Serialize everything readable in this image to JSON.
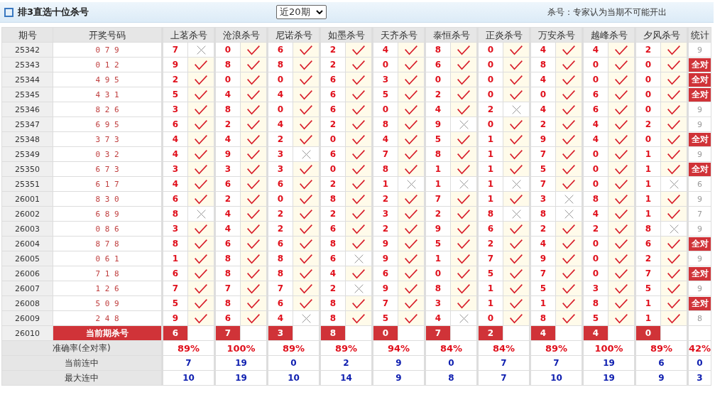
{
  "header": {
    "title": "排3直选十位杀号",
    "period_select": "近20期",
    "note": "杀号：专家认为当期不可能开出"
  },
  "columns": {
    "period": "期号",
    "draw": "开奖号码",
    "stats": "统计"
  },
  "experts": [
    {
      "name": "上茗杀号",
      "current_kill": "6",
      "accuracy": "89%",
      "current_streak": "7",
      "max_streak": "10"
    },
    {
      "name": "沧浪杀号",
      "current_kill": "7",
      "accuracy": "100%",
      "current_streak": "19",
      "max_streak": "19"
    },
    {
      "name": "尼诺杀号",
      "current_kill": "3",
      "accuracy": "89%",
      "current_streak": "0",
      "max_streak": "10"
    },
    {
      "name": "如墨杀号",
      "current_kill": "8",
      "accuracy": "89%",
      "current_streak": "2",
      "max_streak": "14"
    },
    {
      "name": "天齐杀号",
      "current_kill": "0",
      "accuracy": "94%",
      "current_streak": "9",
      "max_streak": "9"
    },
    {
      "name": "泰恒杀号",
      "current_kill": "7",
      "accuracy": "84%",
      "current_streak": "0",
      "max_streak": "8"
    },
    {
      "name": "正炎杀号",
      "current_kill": "2",
      "accuracy": "84%",
      "current_streak": "7",
      "max_streak": "7"
    },
    {
      "name": "万安杀号",
      "current_kill": "4",
      "accuracy": "89%",
      "current_streak": "7",
      "max_streak": "10"
    },
    {
      "name": "越峰杀号",
      "current_kill": "4",
      "accuracy": "100%",
      "current_streak": "19",
      "max_streak": "19"
    },
    {
      "name": "夕风杀号",
      "current_kill": "0",
      "accuracy": "89%",
      "current_streak": "6",
      "max_streak": "9"
    }
  ],
  "rows": [
    {
      "period": "25342",
      "draw": "0 7 9",
      "kills": [
        {
          "number": "7",
          "hit": false
        },
        {
          "number": "0",
          "hit": true
        },
        {
          "number": "6",
          "hit": true
        },
        {
          "number": "2",
          "hit": true
        },
        {
          "number": "4",
          "hit": true
        },
        {
          "number": "8",
          "hit": true
        },
        {
          "number": "0",
          "hit": true
        },
        {
          "number": "4",
          "hit": true
        },
        {
          "number": "4",
          "hit": true
        },
        {
          "number": "2",
          "hit": true
        }
      ],
      "stat": {
        "kind": "count",
        "text": "9"
      }
    },
    {
      "period": "25343",
      "draw": "0 1 2",
      "kills": [
        {
          "number": "9",
          "hit": true
        },
        {
          "number": "8",
          "hit": true
        },
        {
          "number": "8",
          "hit": true
        },
        {
          "number": "2",
          "hit": true
        },
        {
          "number": "0",
          "hit": true
        },
        {
          "number": "6",
          "hit": true
        },
        {
          "number": "0",
          "hit": true
        },
        {
          "number": "8",
          "hit": true
        },
        {
          "number": "0",
          "hit": true
        },
        {
          "number": "0",
          "hit": true
        }
      ],
      "stat": {
        "kind": "all",
        "text": "全对"
      }
    },
    {
      "period": "25344",
      "draw": "4 9 5",
      "kills": [
        {
          "number": "2",
          "hit": true
        },
        {
          "number": "0",
          "hit": true
        },
        {
          "number": "0",
          "hit": true
        },
        {
          "number": "6",
          "hit": true
        },
        {
          "number": "3",
          "hit": true
        },
        {
          "number": "0",
          "hit": true
        },
        {
          "number": "0",
          "hit": true
        },
        {
          "number": "4",
          "hit": true
        },
        {
          "number": "0",
          "hit": true
        },
        {
          "number": "0",
          "hit": true
        }
      ],
      "stat": {
        "kind": "all",
        "text": "全对"
      }
    },
    {
      "period": "25345",
      "draw": "4 3 1",
      "kills": [
        {
          "number": "5",
          "hit": true
        },
        {
          "number": "4",
          "hit": true
        },
        {
          "number": "4",
          "hit": true
        },
        {
          "number": "6",
          "hit": true
        },
        {
          "number": "5",
          "hit": true
        },
        {
          "number": "2",
          "hit": true
        },
        {
          "number": "0",
          "hit": true
        },
        {
          "number": "0",
          "hit": true
        },
        {
          "number": "6",
          "hit": true
        },
        {
          "number": "0",
          "hit": true
        }
      ],
      "stat": {
        "kind": "all",
        "text": "全对"
      }
    },
    {
      "period": "25346",
      "draw": "8 2 6",
      "kills": [
        {
          "number": "3",
          "hit": true
        },
        {
          "number": "8",
          "hit": true
        },
        {
          "number": "0",
          "hit": true
        },
        {
          "number": "6",
          "hit": true
        },
        {
          "number": "0",
          "hit": true
        },
        {
          "number": "4",
          "hit": true
        },
        {
          "number": "2",
          "hit": false
        },
        {
          "number": "4",
          "hit": true
        },
        {
          "number": "6",
          "hit": true
        },
        {
          "number": "0",
          "hit": true
        }
      ],
      "stat": {
        "kind": "count",
        "text": "9"
      }
    },
    {
      "period": "25347",
      "draw": "6 9 5",
      "kills": [
        {
          "number": "6",
          "hit": true
        },
        {
          "number": "2",
          "hit": true
        },
        {
          "number": "4",
          "hit": true
        },
        {
          "number": "2",
          "hit": true
        },
        {
          "number": "8",
          "hit": true
        },
        {
          "number": "9",
          "hit": false
        },
        {
          "number": "0",
          "hit": true
        },
        {
          "number": "2",
          "hit": true
        },
        {
          "number": "4",
          "hit": true
        },
        {
          "number": "2",
          "hit": true
        }
      ],
      "stat": {
        "kind": "count",
        "text": "9"
      }
    },
    {
      "period": "25348",
      "draw": "3 7 3",
      "kills": [
        {
          "number": "4",
          "hit": true
        },
        {
          "number": "4",
          "hit": true
        },
        {
          "number": "2",
          "hit": true
        },
        {
          "number": "0",
          "hit": true
        },
        {
          "number": "4",
          "hit": true
        },
        {
          "number": "5",
          "hit": true
        },
        {
          "number": "1",
          "hit": true
        },
        {
          "number": "9",
          "hit": true
        },
        {
          "number": "4",
          "hit": true
        },
        {
          "number": "0",
          "hit": true
        }
      ],
      "stat": {
        "kind": "all",
        "text": "全对"
      }
    },
    {
      "period": "25349",
      "draw": "0 3 2",
      "kills": [
        {
          "number": "4",
          "hit": true
        },
        {
          "number": "9",
          "hit": true
        },
        {
          "number": "3",
          "hit": false
        },
        {
          "number": "6",
          "hit": true
        },
        {
          "number": "7",
          "hit": true
        },
        {
          "number": "8",
          "hit": true
        },
        {
          "number": "1",
          "hit": true
        },
        {
          "number": "7",
          "hit": true
        },
        {
          "number": "0",
          "hit": true
        },
        {
          "number": "1",
          "hit": true
        }
      ],
      "stat": {
        "kind": "count",
        "text": "9"
      }
    },
    {
      "period": "25350",
      "draw": "6 7 3",
      "kills": [
        {
          "number": "3",
          "hit": true
        },
        {
          "number": "3",
          "hit": true
        },
        {
          "number": "3",
          "hit": true
        },
        {
          "number": "0",
          "hit": true
        },
        {
          "number": "8",
          "hit": true
        },
        {
          "number": "1",
          "hit": true
        },
        {
          "number": "1",
          "hit": true
        },
        {
          "number": "5",
          "hit": true
        },
        {
          "number": "0",
          "hit": true
        },
        {
          "number": "1",
          "hit": true
        }
      ],
      "stat": {
        "kind": "all",
        "text": "全对"
      }
    },
    {
      "period": "25351",
      "draw": "6 1 7",
      "kills": [
        {
          "number": "4",
          "hit": true
        },
        {
          "number": "6",
          "hit": true
        },
        {
          "number": "6",
          "hit": true
        },
        {
          "number": "2",
          "hit": true
        },
        {
          "number": "1",
          "hit": false
        },
        {
          "number": "1",
          "hit": false
        },
        {
          "number": "1",
          "hit": false
        },
        {
          "number": "7",
          "hit": true
        },
        {
          "number": "0",
          "hit": true
        },
        {
          "number": "1",
          "hit": false
        }
      ],
      "stat": {
        "kind": "count",
        "text": "6"
      }
    },
    {
      "period": "26001",
      "draw": "8 3 0",
      "kills": [
        {
          "number": "6",
          "hit": true
        },
        {
          "number": "2",
          "hit": true
        },
        {
          "number": "0",
          "hit": true
        },
        {
          "number": "8",
          "hit": true
        },
        {
          "number": "2",
          "hit": true
        },
        {
          "number": "7",
          "hit": true
        },
        {
          "number": "1",
          "hit": true
        },
        {
          "number": "3",
          "hit": false
        },
        {
          "number": "8",
          "hit": true
        },
        {
          "number": "1",
          "hit": true
        }
      ],
      "stat": {
        "kind": "count",
        "text": "9"
      }
    },
    {
      "period": "26002",
      "draw": "6 8 9",
      "kills": [
        {
          "number": "8",
          "hit": false
        },
        {
          "number": "4",
          "hit": true
        },
        {
          "number": "2",
          "hit": true
        },
        {
          "number": "2",
          "hit": true
        },
        {
          "number": "3",
          "hit": true
        },
        {
          "number": "2",
          "hit": true
        },
        {
          "number": "8",
          "hit": false
        },
        {
          "number": "8",
          "hit": false
        },
        {
          "number": "4",
          "hit": true
        },
        {
          "number": "1",
          "hit": true
        }
      ],
      "stat": {
        "kind": "count",
        "text": "7"
      }
    },
    {
      "period": "26003",
      "draw": "0 8 6",
      "kills": [
        {
          "number": "3",
          "hit": true
        },
        {
          "number": "4",
          "hit": true
        },
        {
          "number": "2",
          "hit": true
        },
        {
          "number": "6",
          "hit": true
        },
        {
          "number": "2",
          "hit": true
        },
        {
          "number": "9",
          "hit": true
        },
        {
          "number": "6",
          "hit": true
        },
        {
          "number": "2",
          "hit": true
        },
        {
          "number": "2",
          "hit": true
        },
        {
          "number": "8",
          "hit": false
        }
      ],
      "stat": {
        "kind": "count",
        "text": "9"
      }
    },
    {
      "period": "26004",
      "draw": "8 7 8",
      "kills": [
        {
          "number": "8",
          "hit": true
        },
        {
          "number": "6",
          "hit": true
        },
        {
          "number": "6",
          "hit": true
        },
        {
          "number": "8",
          "hit": true
        },
        {
          "number": "9",
          "hit": true
        },
        {
          "number": "5",
          "hit": true
        },
        {
          "number": "2",
          "hit": true
        },
        {
          "number": "4",
          "hit": true
        },
        {
          "number": "0",
          "hit": true
        },
        {
          "number": "6",
          "hit": true
        }
      ],
      "stat": {
        "kind": "all",
        "text": "全对"
      }
    },
    {
      "period": "26005",
      "draw": "0 6 1",
      "kills": [
        {
          "number": "1",
          "hit": true
        },
        {
          "number": "8",
          "hit": true
        },
        {
          "number": "8",
          "hit": true
        },
        {
          "number": "6",
          "hit": false
        },
        {
          "number": "9",
          "hit": true
        },
        {
          "number": "1",
          "hit": true
        },
        {
          "number": "7",
          "hit": true
        },
        {
          "number": "9",
          "hit": true
        },
        {
          "number": "0",
          "hit": true
        },
        {
          "number": "2",
          "hit": true
        }
      ],
      "stat": {
        "kind": "count",
        "text": "9"
      }
    },
    {
      "period": "26006",
      "draw": "7 1 8",
      "kills": [
        {
          "number": "6",
          "hit": true
        },
        {
          "number": "8",
          "hit": true
        },
        {
          "number": "8",
          "hit": true
        },
        {
          "number": "4",
          "hit": true
        },
        {
          "number": "6",
          "hit": true
        },
        {
          "number": "0",
          "hit": true
        },
        {
          "number": "5",
          "hit": true
        },
        {
          "number": "7",
          "hit": true
        },
        {
          "number": "0",
          "hit": true
        },
        {
          "number": "7",
          "hit": true
        }
      ],
      "stat": {
        "kind": "all",
        "text": "全对"
      }
    },
    {
      "period": "26007",
      "draw": "1 2 6",
      "kills": [
        {
          "number": "7",
          "hit": true
        },
        {
          "number": "7",
          "hit": true
        },
        {
          "number": "7",
          "hit": true
        },
        {
          "number": "2",
          "hit": false
        },
        {
          "number": "9",
          "hit": true
        },
        {
          "number": "8",
          "hit": true
        },
        {
          "number": "1",
          "hit": true
        },
        {
          "number": "5",
          "hit": true
        },
        {
          "number": "3",
          "hit": true
        },
        {
          "number": "5",
          "hit": true
        }
      ],
      "stat": {
        "kind": "count",
        "text": "9"
      }
    },
    {
      "period": "26008",
      "draw": "5 0 9",
      "kills": [
        {
          "number": "5",
          "hit": true
        },
        {
          "number": "8",
          "hit": true
        },
        {
          "number": "6",
          "hit": true
        },
        {
          "number": "8",
          "hit": true
        },
        {
          "number": "7",
          "hit": true
        },
        {
          "number": "3",
          "hit": true
        },
        {
          "number": "1",
          "hit": true
        },
        {
          "number": "1",
          "hit": true
        },
        {
          "number": "8",
          "hit": true
        },
        {
          "number": "1",
          "hit": true
        }
      ],
      "stat": {
        "kind": "all",
        "text": "全对"
      }
    },
    {
      "period": "26009",
      "draw": "2 4 8",
      "kills": [
        {
          "number": "9",
          "hit": true
        },
        {
          "number": "6",
          "hit": true
        },
        {
          "number": "4",
          "hit": false
        },
        {
          "number": "8",
          "hit": true
        },
        {
          "number": "5",
          "hit": true
        },
        {
          "number": "4",
          "hit": false
        },
        {
          "number": "0",
          "hit": true
        },
        {
          "number": "8",
          "hit": true
        },
        {
          "number": "5",
          "hit": true
        },
        {
          "number": "1",
          "hit": true
        }
      ],
      "stat": {
        "kind": "count",
        "text": "8"
      }
    }
  ],
  "current": {
    "period": "26010",
    "label": "当前期杀号"
  },
  "summary": {
    "accuracy_label": "准确率(全对率)",
    "accuracy_total": "42%",
    "current_label": "当前连中",
    "current_total": "0",
    "max_label": "最大连中",
    "max_total": "3"
  }
}
